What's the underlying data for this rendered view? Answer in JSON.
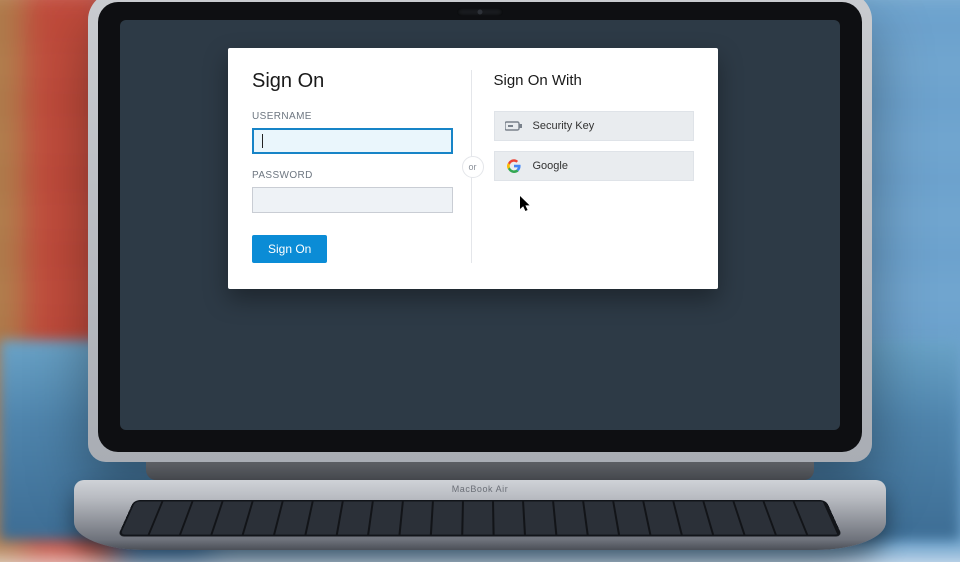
{
  "device": {
    "brand": "MacBook Air"
  },
  "signon": {
    "title": "Sign On",
    "username_label": "USERNAME",
    "username_value": "",
    "password_label": "PASSWORD",
    "password_value": "",
    "submit_label": "Sign On"
  },
  "divider": {
    "or_label": "or"
  },
  "sso": {
    "title": "Sign On With",
    "providers": [
      {
        "id": "security-key",
        "label": "Security Key",
        "icon": "security-key-icon"
      },
      {
        "id": "google",
        "label": "Google",
        "icon": "google-icon"
      }
    ]
  }
}
